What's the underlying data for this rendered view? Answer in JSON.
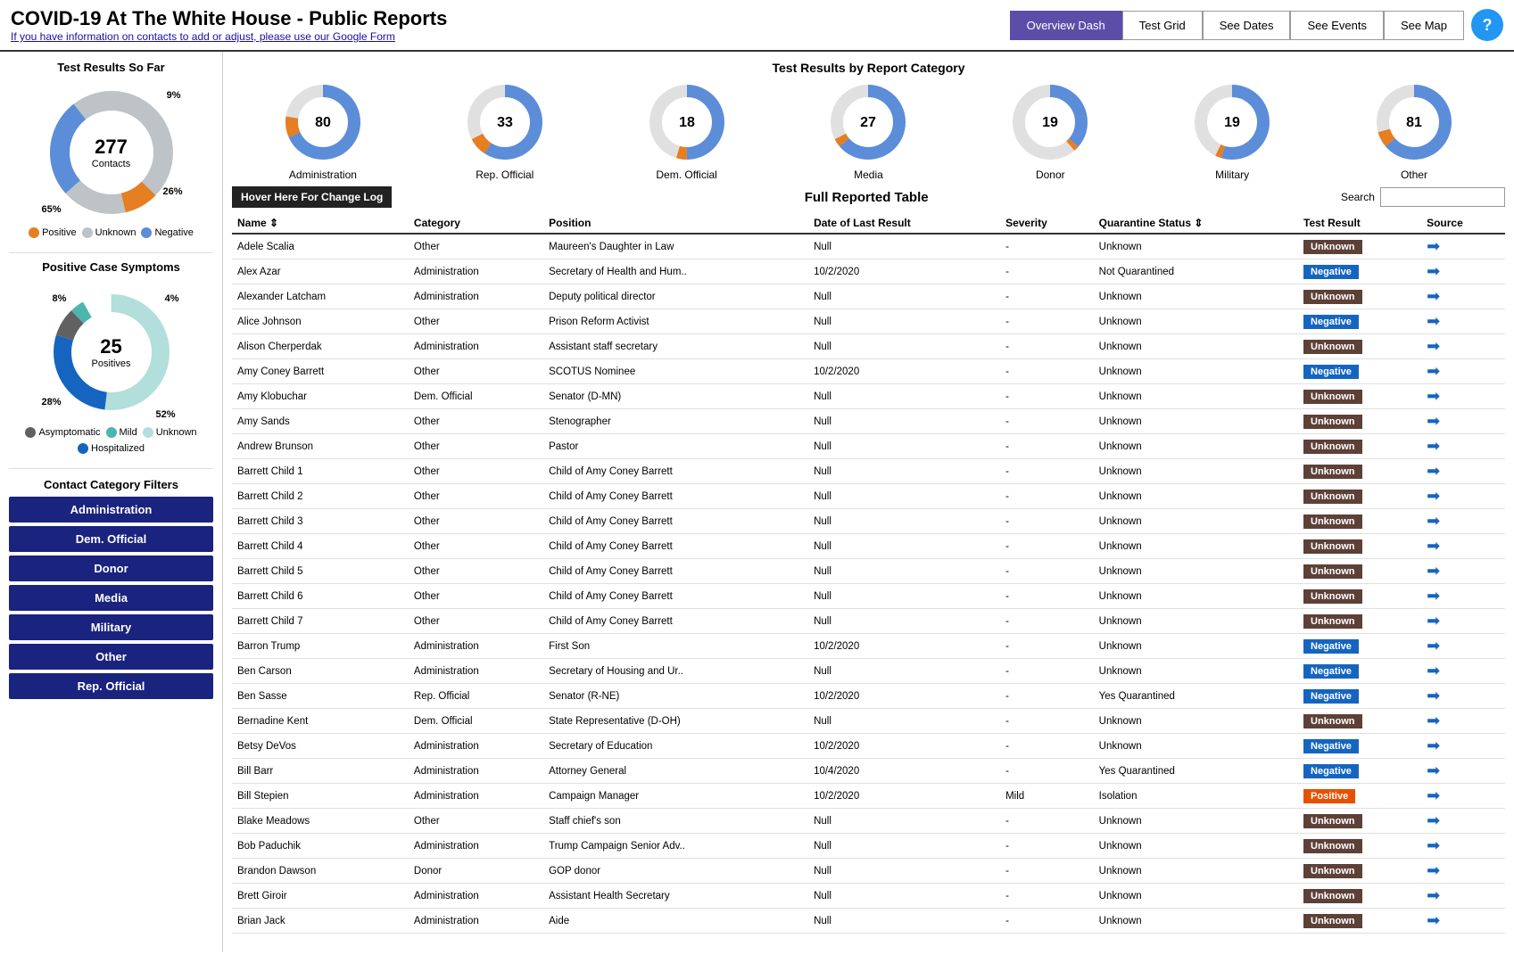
{
  "header": {
    "title": "COVID-19 At The White House - Public Reports",
    "subtitle": "If you have information on contacts to add or adjust, please use our Google Form",
    "nav": [
      {
        "label": "Overview Dash",
        "active": true
      },
      {
        "label": "Test Grid",
        "active": false
      },
      {
        "label": "See Dates",
        "active": false
      },
      {
        "label": "See Events",
        "active": false
      },
      {
        "label": "See Map",
        "active": false
      }
    ],
    "help": "?"
  },
  "left": {
    "test_results_title": "Test Results So Far",
    "total_contacts": "277",
    "total_label": "Contacts",
    "pct_positive": "9%",
    "pct_negative": "26%",
    "pct_unknown": "65%",
    "legend": [
      {
        "label": "Positive",
        "color": "#e67e22"
      },
      {
        "label": "Unknown",
        "color": "#bdc3c7"
      },
      {
        "label": "Negative",
        "color": "#5b8dd9"
      }
    ],
    "symptoms_title": "Positive Case Symptoms",
    "total_positives": "25",
    "positives_label": "Positives",
    "pct_asymptomatic": "8%",
    "pct_mild": "4%",
    "pct_hospitalized": "28%",
    "pct_unknown_sym": "52%",
    "symptoms_legend": [
      {
        "label": "Asymptomatic",
        "color": "#616161"
      },
      {
        "label": "Mild",
        "color": "#4db6ac"
      },
      {
        "label": "Unknown",
        "color": "#b2dfdb"
      },
      {
        "label": "Hospitalized",
        "color": "#1565c0"
      }
    ],
    "filters_title": "Contact Category Filters",
    "filters": [
      "Administration",
      "Dem. Official",
      "Donor",
      "Media",
      "Military",
      "Other",
      "Rep. Official"
    ]
  },
  "categories": {
    "title": "Test Results by Report Category",
    "items": [
      {
        "label": "Administration",
        "value": 80
      },
      {
        "label": "Rep. Official",
        "value": 33
      },
      {
        "label": "Dem. Official",
        "value": 18
      },
      {
        "label": "Media",
        "value": 27
      },
      {
        "label": "Donor",
        "value": 19
      },
      {
        "label": "Military",
        "value": 19
      },
      {
        "label": "Other",
        "value": 81
      }
    ]
  },
  "table": {
    "change_log_btn": "Hover Here For Change Log",
    "title": "Full Reported Table",
    "search_label": "Search",
    "columns": [
      "Name",
      "Category",
      "Position",
      "Date of Last Result",
      "Severity",
      "Quarantine Status",
      "Test Result",
      "Source"
    ],
    "rows": [
      {
        "name": "Adele Scalia",
        "category": "Other",
        "position": "Maureen's Daughter in Law",
        "date": "Null",
        "severity": "-",
        "quarantine": "Unknown",
        "result": "Unknown",
        "result_type": "badge"
      },
      {
        "name": "Alex Azar",
        "category": "Administration",
        "position": "Secretary of Health and Hum..",
        "date": "10/2/2020",
        "severity": "-",
        "quarantine": "Not Quarantined",
        "result": "Negative",
        "result_type": "badge"
      },
      {
        "name": "Alexander Latcham",
        "category": "Administration",
        "position": "Deputy political director",
        "date": "Null",
        "severity": "-",
        "quarantine": "Unknown",
        "result": "Unknown",
        "result_type": "badge"
      },
      {
        "name": "Alice Johnson",
        "category": "Other",
        "position": "Prison Reform Activist",
        "date": "Null",
        "severity": "-",
        "quarantine": "Unknown",
        "result": "Negative",
        "result_type": "badge"
      },
      {
        "name": "Alison Cherperdak",
        "category": "Administration",
        "position": "Assistant staff secretary",
        "date": "Null",
        "severity": "-",
        "quarantine": "Unknown",
        "result": "Unknown",
        "result_type": "badge"
      },
      {
        "name": "Amy Coney Barrett",
        "category": "Other",
        "position": "SCOTUS Nominee",
        "date": "10/2/2020",
        "severity": "-",
        "quarantine": "Unknown",
        "result": "Negative",
        "result_type": "badge"
      },
      {
        "name": "Amy Klobuchar",
        "category": "Dem. Official",
        "position": "Senator (D-MN)",
        "date": "Null",
        "severity": "-",
        "quarantine": "Unknown",
        "result": "Unknown",
        "result_type": "badge"
      },
      {
        "name": "Amy Sands",
        "category": "Other",
        "position": "Stenographer",
        "date": "Null",
        "severity": "-",
        "quarantine": "Unknown",
        "result": "Unknown",
        "result_type": "badge"
      },
      {
        "name": "Andrew Brunson",
        "category": "Other",
        "position": "Pastor",
        "date": "Null",
        "severity": "-",
        "quarantine": "Unknown",
        "result": "Unknown",
        "result_type": "badge"
      },
      {
        "name": "Barrett Child 1",
        "category": "Other",
        "position": "Child of Amy Coney Barrett",
        "date": "Null",
        "severity": "-",
        "quarantine": "Unknown",
        "result": "Unknown",
        "result_type": "badge"
      },
      {
        "name": "Barrett Child 2",
        "category": "Other",
        "position": "Child of Amy Coney Barrett",
        "date": "Null",
        "severity": "-",
        "quarantine": "Unknown",
        "result": "Unknown",
        "result_type": "badge"
      },
      {
        "name": "Barrett Child 3",
        "category": "Other",
        "position": "Child of Amy Coney Barrett",
        "date": "Null",
        "severity": "-",
        "quarantine": "Unknown",
        "result": "Unknown",
        "result_type": "badge"
      },
      {
        "name": "Barrett Child 4",
        "category": "Other",
        "position": "Child of Amy Coney Barrett",
        "date": "Null",
        "severity": "-",
        "quarantine": "Unknown",
        "result": "Unknown",
        "result_type": "badge"
      },
      {
        "name": "Barrett Child 5",
        "category": "Other",
        "position": "Child of Amy Coney Barrett",
        "date": "Null",
        "severity": "-",
        "quarantine": "Unknown",
        "result": "Unknown",
        "result_type": "badge"
      },
      {
        "name": "Barrett Child 6",
        "category": "Other",
        "position": "Child of Amy Coney Barrett",
        "date": "Null",
        "severity": "-",
        "quarantine": "Unknown",
        "result": "Unknown",
        "result_type": "badge"
      },
      {
        "name": "Barrett Child 7",
        "category": "Other",
        "position": "Child of Amy Coney Barrett",
        "date": "Null",
        "severity": "-",
        "quarantine": "Unknown",
        "result": "Unknown",
        "result_type": "badge"
      },
      {
        "name": "Barron Trump",
        "category": "Administration",
        "position": "First Son",
        "date": "10/2/2020",
        "severity": "-",
        "quarantine": "Unknown",
        "result": "Negative",
        "result_type": "badge"
      },
      {
        "name": "Ben Carson",
        "category": "Administration",
        "position": "Secretary of Housing and Ur..",
        "date": "Null",
        "severity": "-",
        "quarantine": "Unknown",
        "result": "Negative",
        "result_type": "badge"
      },
      {
        "name": "Ben Sasse",
        "category": "Rep. Official",
        "position": "Senator (R-NE)",
        "date": "10/2/2020",
        "severity": "-",
        "quarantine": "Yes Quarantined",
        "result": "Negative",
        "result_type": "badge"
      },
      {
        "name": "Bernadine Kent",
        "category": "Dem. Official",
        "position": "State Representative (D-OH)",
        "date": "Null",
        "severity": "-",
        "quarantine": "Unknown",
        "result": "Unknown",
        "result_type": "badge"
      },
      {
        "name": "Betsy DeVos",
        "category": "Administration",
        "position": "Secretary of Education",
        "date": "10/2/2020",
        "severity": "-",
        "quarantine": "Unknown",
        "result": "Negative",
        "result_type": "badge"
      },
      {
        "name": "Bill Barr",
        "category": "Administration",
        "position": "Attorney General",
        "date": "10/4/2020",
        "severity": "-",
        "quarantine": "Yes Quarantined",
        "result": "Negative",
        "result_type": "badge"
      },
      {
        "name": "Bill Stepien",
        "category": "Administration",
        "position": "Campaign Manager",
        "date": "10/2/2020",
        "severity": "Mild",
        "quarantine": "Isolation",
        "result": "Positive",
        "result_type": "badge"
      },
      {
        "name": "Blake Meadows",
        "category": "Other",
        "position": "Staff chief's son",
        "date": "Null",
        "severity": "-",
        "quarantine": "Unknown",
        "result": "Unknown",
        "result_type": "badge"
      },
      {
        "name": "Bob Paduchik",
        "category": "Administration",
        "position": "Trump Campaign Senior Adv..",
        "date": "Null",
        "severity": "-",
        "quarantine": "Unknown",
        "result": "Unknown",
        "result_type": "badge"
      },
      {
        "name": "Brandon Dawson",
        "category": "Donor",
        "position": "GOP donor",
        "date": "Null",
        "severity": "-",
        "quarantine": "Unknown",
        "result": "Unknown",
        "result_type": "badge"
      },
      {
        "name": "Brett Giroir",
        "category": "Administration",
        "position": "Assistant Health Secretary",
        "date": "Null",
        "severity": "-",
        "quarantine": "Unknown",
        "result": "Unknown",
        "result_type": "badge"
      },
      {
        "name": "Brian Jack",
        "category": "Administration",
        "position": "Aide",
        "date": "Null",
        "severity": "-",
        "quarantine": "Unknown",
        "result": "Unknown",
        "result_type": "badge"
      }
    ]
  }
}
